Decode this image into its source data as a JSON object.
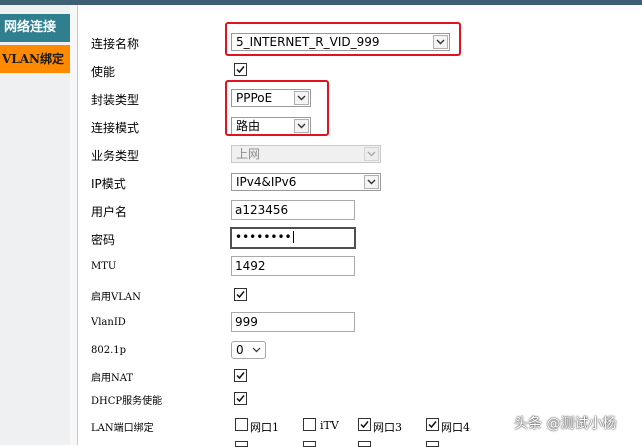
{
  "sidebar": {
    "items": [
      {
        "label": "网络连接"
      },
      {
        "label": "VLAN绑定"
      }
    ]
  },
  "form": {
    "connection_name": {
      "label": "连接名称",
      "value": "5_INTERNET_R_VID_999"
    },
    "enable": {
      "label": "使能",
      "checked": true
    },
    "encapsulation": {
      "label": "封装类型",
      "value": "PPPoE"
    },
    "connection_mode": {
      "label": "连接模式",
      "value": "路由"
    },
    "service_type": {
      "label": "业务类型",
      "value": "上网",
      "disabled": true
    },
    "ip_mode": {
      "label": "IP模式",
      "value": "IPv4&IPv6"
    },
    "username": {
      "label": "用户名",
      "value": "a123456"
    },
    "password": {
      "label": "密码",
      "value": "••••••••"
    },
    "mtu": {
      "label": "MTU",
      "value": "1492"
    },
    "enable_vlan": {
      "label": "启用VLAN",
      "checked": true
    },
    "vlan_id": {
      "label": "VlanID",
      "value": "999"
    },
    "priority": {
      "label": "802.1p",
      "value": "0"
    },
    "enable_nat": {
      "label": "启用NAT",
      "checked": true
    },
    "dhcp_service": {
      "label": "DHCP服务使能",
      "checked": true
    },
    "lan_binding": {
      "label": "LAN端口绑定",
      "ports": [
        {
          "label": "网口1",
          "checked": false
        },
        {
          "label": "iTV",
          "checked": false
        },
        {
          "label": "网口3",
          "checked": true
        },
        {
          "label": "网口4",
          "checked": true
        }
      ]
    }
  },
  "watermark": "头条 @测试小杨",
  "colors": {
    "highlight": "#e0141e",
    "sidebar_active": "#2f7f8f",
    "sidebar_vlan": "#ff8a00"
  }
}
